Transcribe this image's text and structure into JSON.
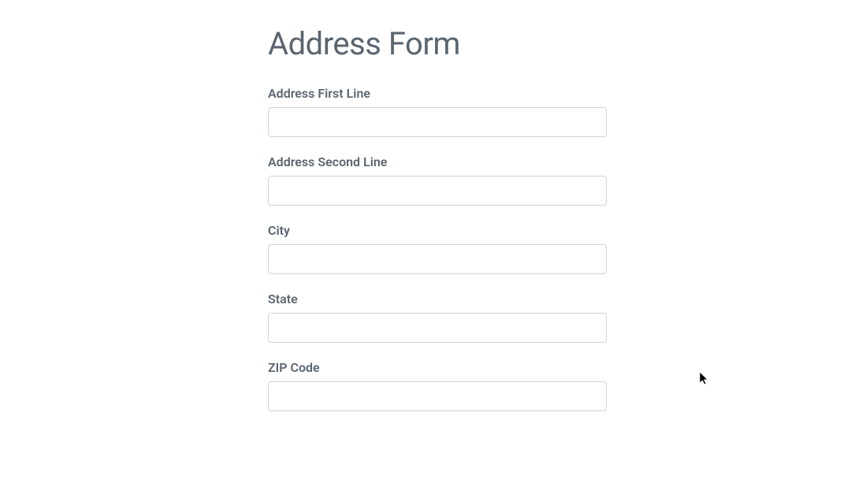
{
  "title": "Address Form",
  "fields": [
    {
      "label": "Address First Line",
      "value": ""
    },
    {
      "label": "Address Second Line",
      "value": ""
    },
    {
      "label": "City",
      "value": ""
    },
    {
      "label": "State",
      "value": ""
    },
    {
      "label": "ZIP Code",
      "value": ""
    }
  ]
}
